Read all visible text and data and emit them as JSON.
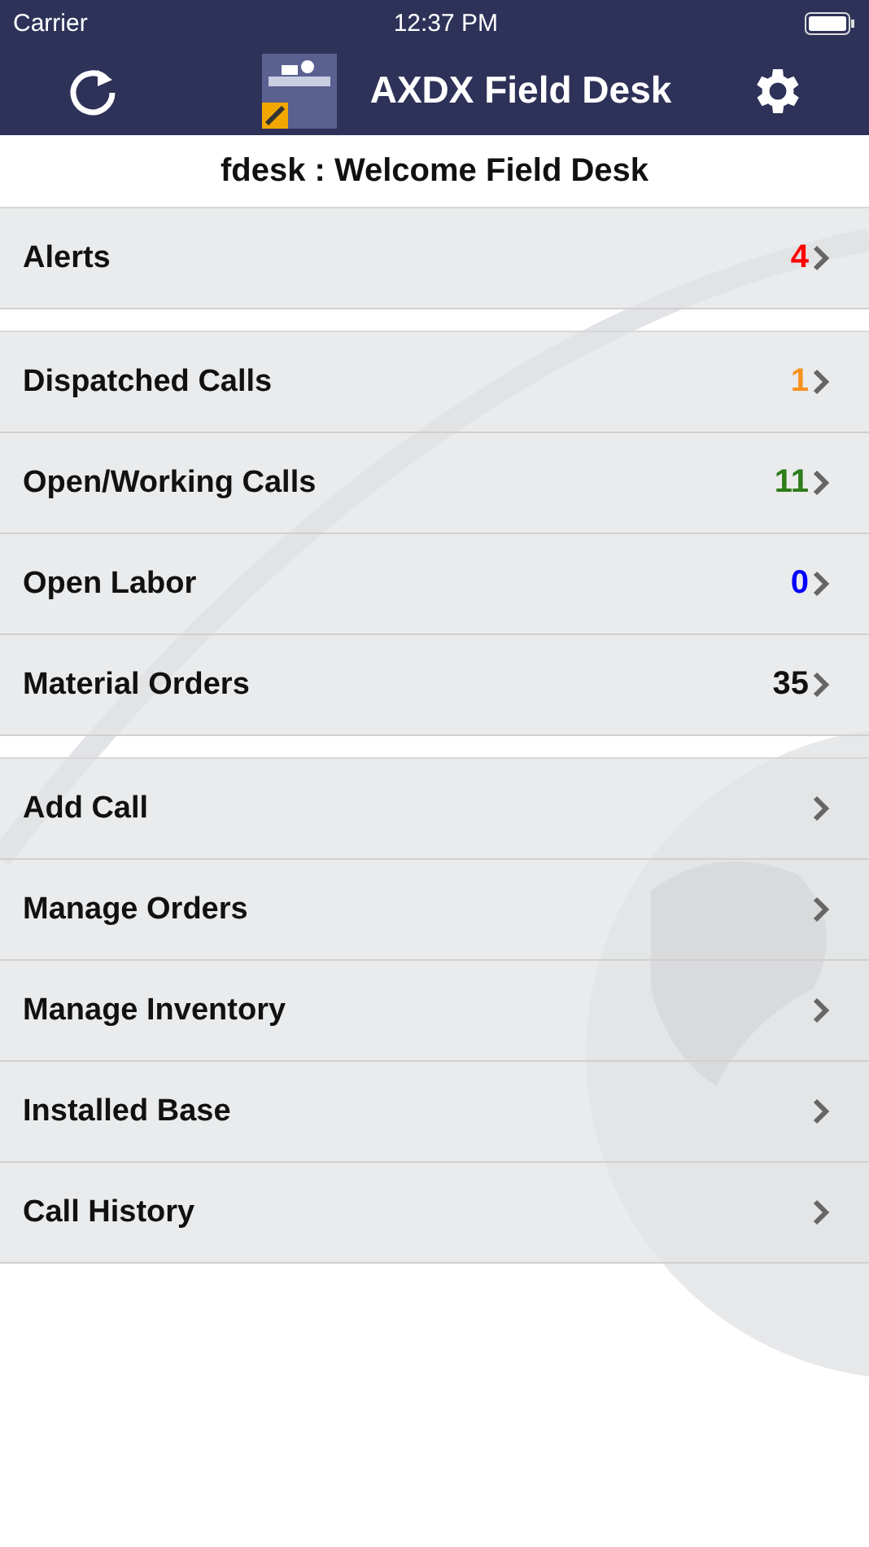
{
  "status_bar": {
    "carrier": "Carrier",
    "time": "12:37 PM"
  },
  "nav_bar": {
    "title": "AXDX Field Desk"
  },
  "subtitle": "fdesk : Welcome Field Desk",
  "sections": [
    {
      "rows": [
        {
          "label": "Alerts",
          "count": "4",
          "color": "#ff0000"
        }
      ]
    },
    {
      "rows": [
        {
          "label": "Dispatched Calls",
          "count": "1",
          "color": "#f7931e"
        },
        {
          "label": "Open/Working Calls",
          "count": "11",
          "color": "#2e7d1a"
        },
        {
          "label": "Open Labor",
          "count": "0",
          "color": "#0000ff"
        },
        {
          "label": "Material Orders",
          "count": "35",
          "color": "#111111"
        }
      ]
    },
    {
      "rows": [
        {
          "label": "Add Call"
        },
        {
          "label": "Manage Orders"
        },
        {
          "label": "Manage Inventory"
        },
        {
          "label": "Installed Base"
        },
        {
          "label": "Call History"
        }
      ]
    }
  ]
}
